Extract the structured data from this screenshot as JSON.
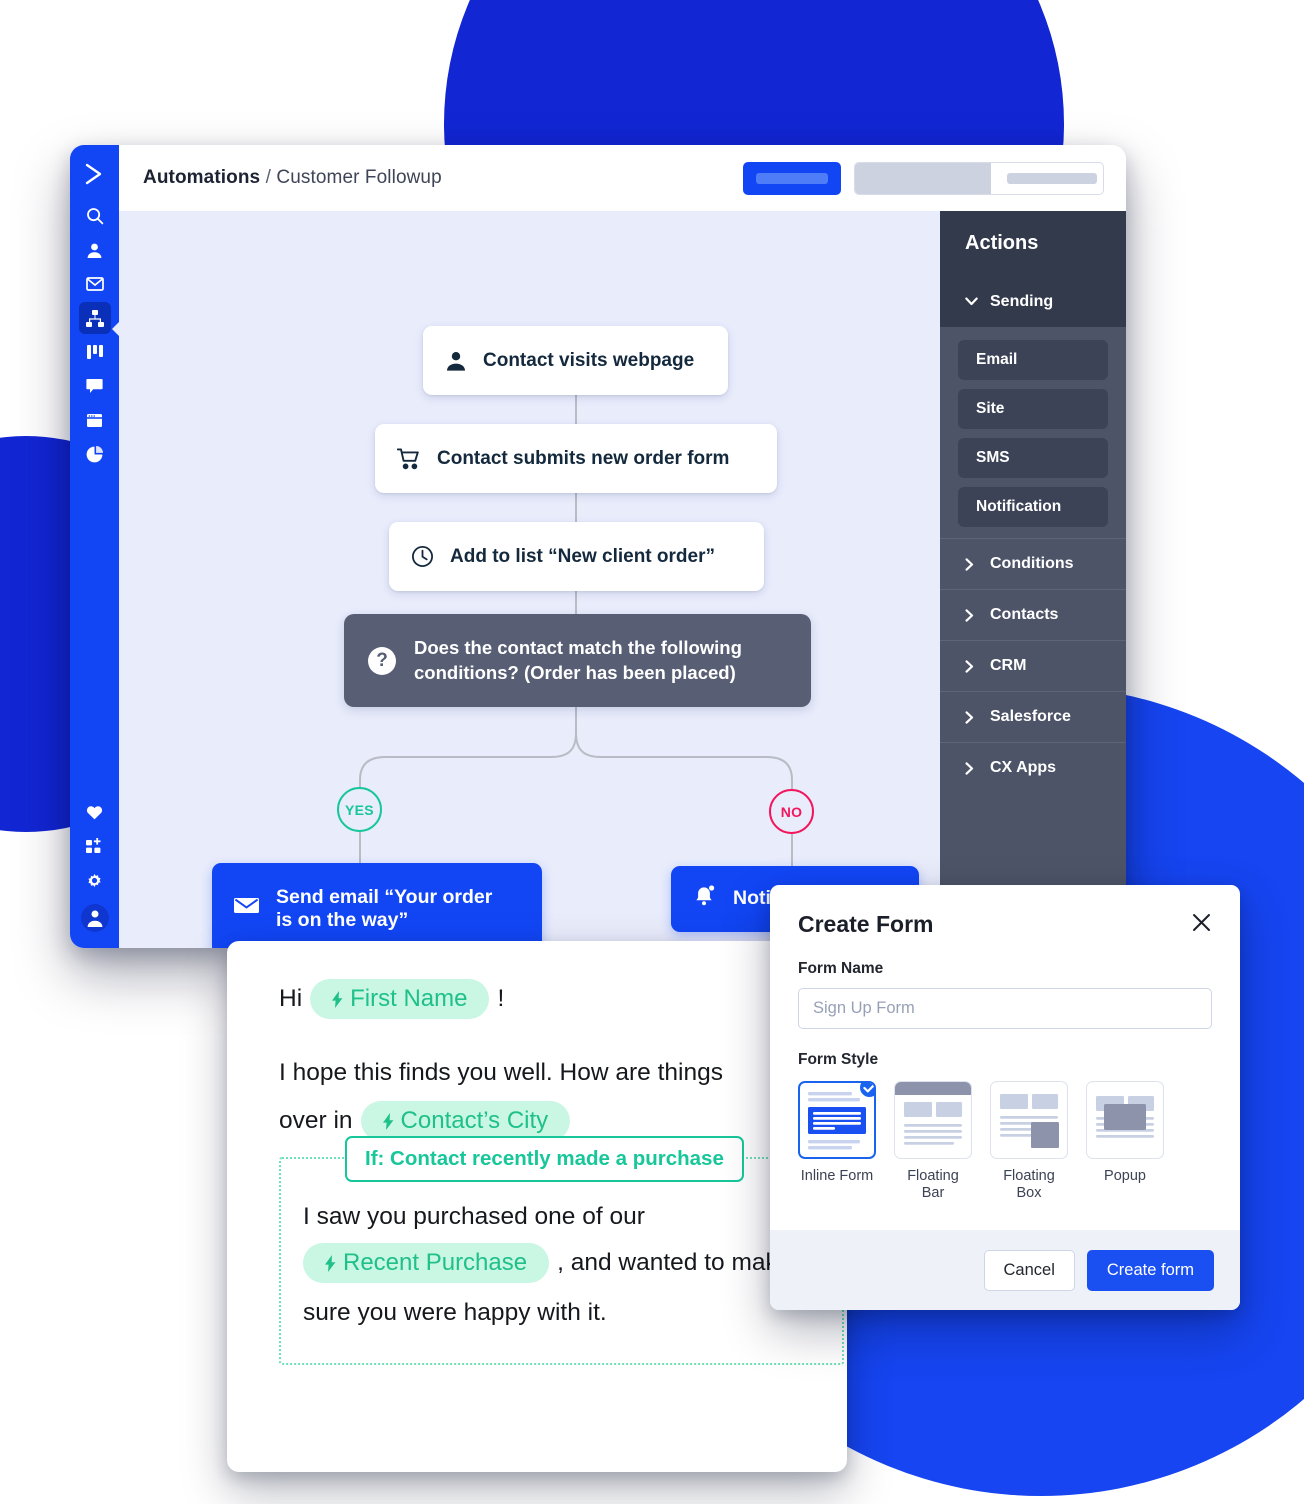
{
  "background": {
    "accent_dark": "#1226d4",
    "accent": "#1645f1"
  },
  "app": {
    "rail": {
      "logo_icon": "activecampaign-chevron-logo-icon",
      "items": [
        {
          "icon": "search-icon",
          "name": "search",
          "active": false
        },
        {
          "icon": "contact-person-icon",
          "name": "contacts",
          "active": false
        },
        {
          "icon": "envelope-icon",
          "name": "campaigns",
          "active": false
        },
        {
          "icon": "automations-flow-icon",
          "name": "automations",
          "active": true
        },
        {
          "icon": "kanban-columns-icon",
          "name": "deals",
          "active": false
        },
        {
          "icon": "chat-bubble-icon",
          "name": "conversations",
          "active": false
        },
        {
          "icon": "website-window-icon",
          "name": "website",
          "active": false
        },
        {
          "icon": "pie-chart-icon",
          "name": "reports",
          "active": false
        }
      ],
      "bottom_items": [
        {
          "icon": "heart-icon",
          "name": "favorites"
        },
        {
          "icon": "apps-add-icon",
          "name": "apps"
        },
        {
          "icon": "gear-icon",
          "name": "settings"
        }
      ],
      "avatar_icon": "user-avatar-icon"
    },
    "topbar": {
      "breadcrumb_root": "Automations",
      "breadcrumb_separator": "/",
      "breadcrumb_current": "Customer Followup",
      "primary_placeholder": "skeleton-button",
      "group_placeholder": "skeleton-segmented-control"
    },
    "flow": {
      "nodes": [
        {
          "id": "n1",
          "icon": "contact-person-icon",
          "label": "Contact visits webpage"
        },
        {
          "id": "n2",
          "icon": "shopping-cart-icon",
          "label": "Contact submits new order form"
        },
        {
          "id": "n3",
          "icon": "clock-icon",
          "label": "Add to list “New client order”"
        }
      ],
      "condition": {
        "icon": "question-mark-icon",
        "line1": "Does the contact match the following",
        "line2": "conditions? (Order has been placed)"
      },
      "branches": [
        {
          "label": "YES",
          "color": "#17c79a"
        },
        {
          "label": "NO",
          "color": "#f2165d"
        }
      ],
      "actions": [
        {
          "icon": "envelope-icon",
          "line1": "Send email “Your order",
          "line2": "is on the way”"
        },
        {
          "icon": "bell-icon",
          "line1": "Notify Sales Rep",
          "line2": ""
        }
      ]
    },
    "actions_panel": {
      "title": "Actions",
      "sections": [
        {
          "label": "Sending",
          "expanded": true,
          "icon": "chevron-down-icon",
          "items": [
            "Email",
            "Site",
            "SMS",
            "Notification"
          ]
        },
        {
          "label": "Conditions",
          "expanded": false,
          "icon": "chevron-right-icon",
          "items": []
        },
        {
          "label": "Contacts",
          "expanded": false,
          "icon": "chevron-right-icon",
          "items": []
        },
        {
          "label": "CRM",
          "expanded": false,
          "icon": "chevron-right-icon",
          "items": []
        },
        {
          "label": "Salesforce",
          "expanded": false,
          "icon": "chevron-right-icon",
          "items": []
        },
        {
          "label": "CX Apps",
          "expanded": false,
          "icon": "chevron-right-icon",
          "items": []
        }
      ]
    }
  },
  "email_editor": {
    "greeting_prefix": "Hi",
    "greeting_tag": "First Name",
    "greeting_suffix": "!",
    "body_line_1": "I hope this finds you well. How are things",
    "body_line_2_prefix": "over in",
    "body_tag_city": "Contact’s City",
    "conditional": {
      "label": "If: Contact recently made a purchase",
      "text_before": "I saw you purchased one of our",
      "tag": "Recent Purchase",
      "text_after": ", and wanted to make",
      "text_end": "sure you were happy with it."
    },
    "tag_icon": "lightning-bolt-icon"
  },
  "modal": {
    "title": "Create Form",
    "close_icon": "close-x-icon",
    "form_name_label": "Form Name",
    "form_name_value": "",
    "form_name_placeholder": "Sign Up Form",
    "form_style_label": "Form Style",
    "styles": [
      {
        "name": "Inline Form",
        "selected": true,
        "check_icon": "check-circle-icon"
      },
      {
        "name": "Floating Bar",
        "selected": false,
        "check_icon": ""
      },
      {
        "name": "Floating Box",
        "selected": false,
        "check_icon": ""
      },
      {
        "name": "Popup",
        "selected": false,
        "check_icon": ""
      }
    ],
    "cancel_label": "Cancel",
    "submit_label": "Create form"
  }
}
